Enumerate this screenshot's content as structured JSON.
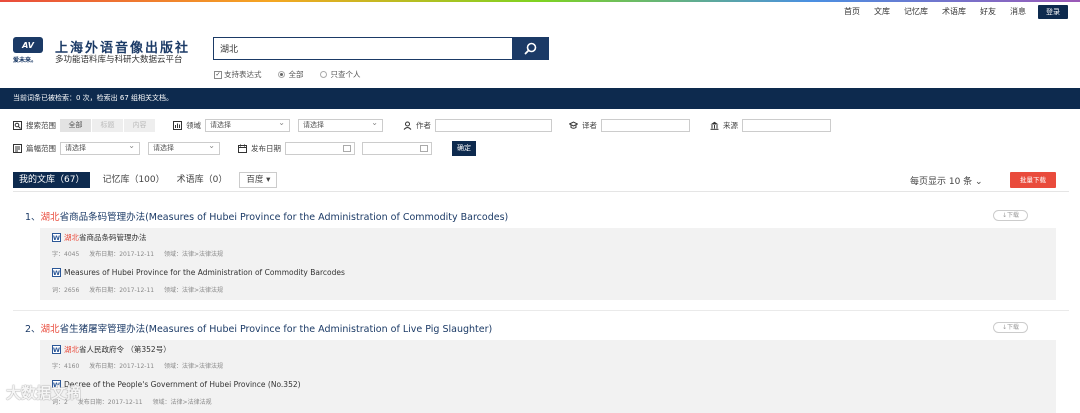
{
  "nav": {
    "links": [
      "首页",
      "文库",
      "记忆库",
      "术语库",
      "好友",
      "消息"
    ],
    "login_label": "登录"
  },
  "brand": {
    "logo_text": "AV",
    "logo_sub": "爱未来。",
    "title": "上海外语音像出版社",
    "subtitle": "多功能语料库与科研大数据云平台"
  },
  "search": {
    "value": "湖北",
    "options": {
      "regex_label": "支持表达式",
      "regex_checked": "☑",
      "all_label": "全部",
      "personal_label": "只查个人"
    }
  },
  "status": {
    "text": "当前词条已被检索：0 次，检索出 67 组相关文档。"
  },
  "filters": {
    "scope_label": "搜索范围",
    "scope_options": [
      "全部",
      "标题",
      "内容"
    ],
    "domain_label": "领域",
    "domain_select_1": "请选择",
    "domain_select_2": "请选择",
    "author_label": "作者",
    "translator_label": "译者",
    "source_label": "来源",
    "length_label": "篇幅范围",
    "length_select_1": "请选择",
    "length_select_2": "请选择",
    "date_label": "发布日期",
    "confirm_label": "确定"
  },
  "tabs": {
    "items": [
      "我的文库（67）",
      "记忆库（100）",
      "术语库（0）"
    ],
    "baidu_label": "百度 ▾",
    "per_page": "每页显示 10 条 ⌄",
    "batch_download": "批量下载"
  },
  "results": [
    {
      "index": "1、",
      "highlight": "湖北",
      "title_rest": "省商品条码管理办法(Measures of Hubei Province for the Administration of Commodity Barcodes)",
      "download": "↓下载",
      "entries": [
        {
          "icon": "W",
          "highlight": "湖北",
          "text": "省商品条码管理办法",
          "count": "字：4045",
          "date": "发布日期：2017-12-11",
          "domain": "领域：法律>法律法规"
        },
        {
          "icon": "W",
          "highlight": "",
          "text": "Measures of Hubei Province for the Administration of Commodity Barcodes",
          "count": "词：2656",
          "date": "发布日期：2017-12-11",
          "domain": "领域：法律>法律法规"
        }
      ]
    },
    {
      "index": "2、",
      "highlight": "湖北",
      "title_rest": "省生猪屠宰管理办法(Measures of Hubei Province for the Administration of Live Pig Slaughter)",
      "download": "↓下载",
      "entries": [
        {
          "icon": "W",
          "highlight": "湖北",
          "text": "省人民政府令 （第352号）",
          "count": "字：4160",
          "date": "发布日期：2017-12-11",
          "domain": "领域：法律>法律法规"
        },
        {
          "icon": "W",
          "highlight": "",
          "text": "Decree of the People's Government of Hubei Province (No.352)",
          "count": "词：2",
          "date": "发布日期：2017-12-11",
          "domain": "领域：法律>法律法规"
        }
      ]
    }
  ],
  "watermark": "大数据文摘",
  "colors": {
    "brand_navy": "#1b3a66",
    "header_bar": "#0d2a4e",
    "highlight_red": "#e94b3c"
  }
}
